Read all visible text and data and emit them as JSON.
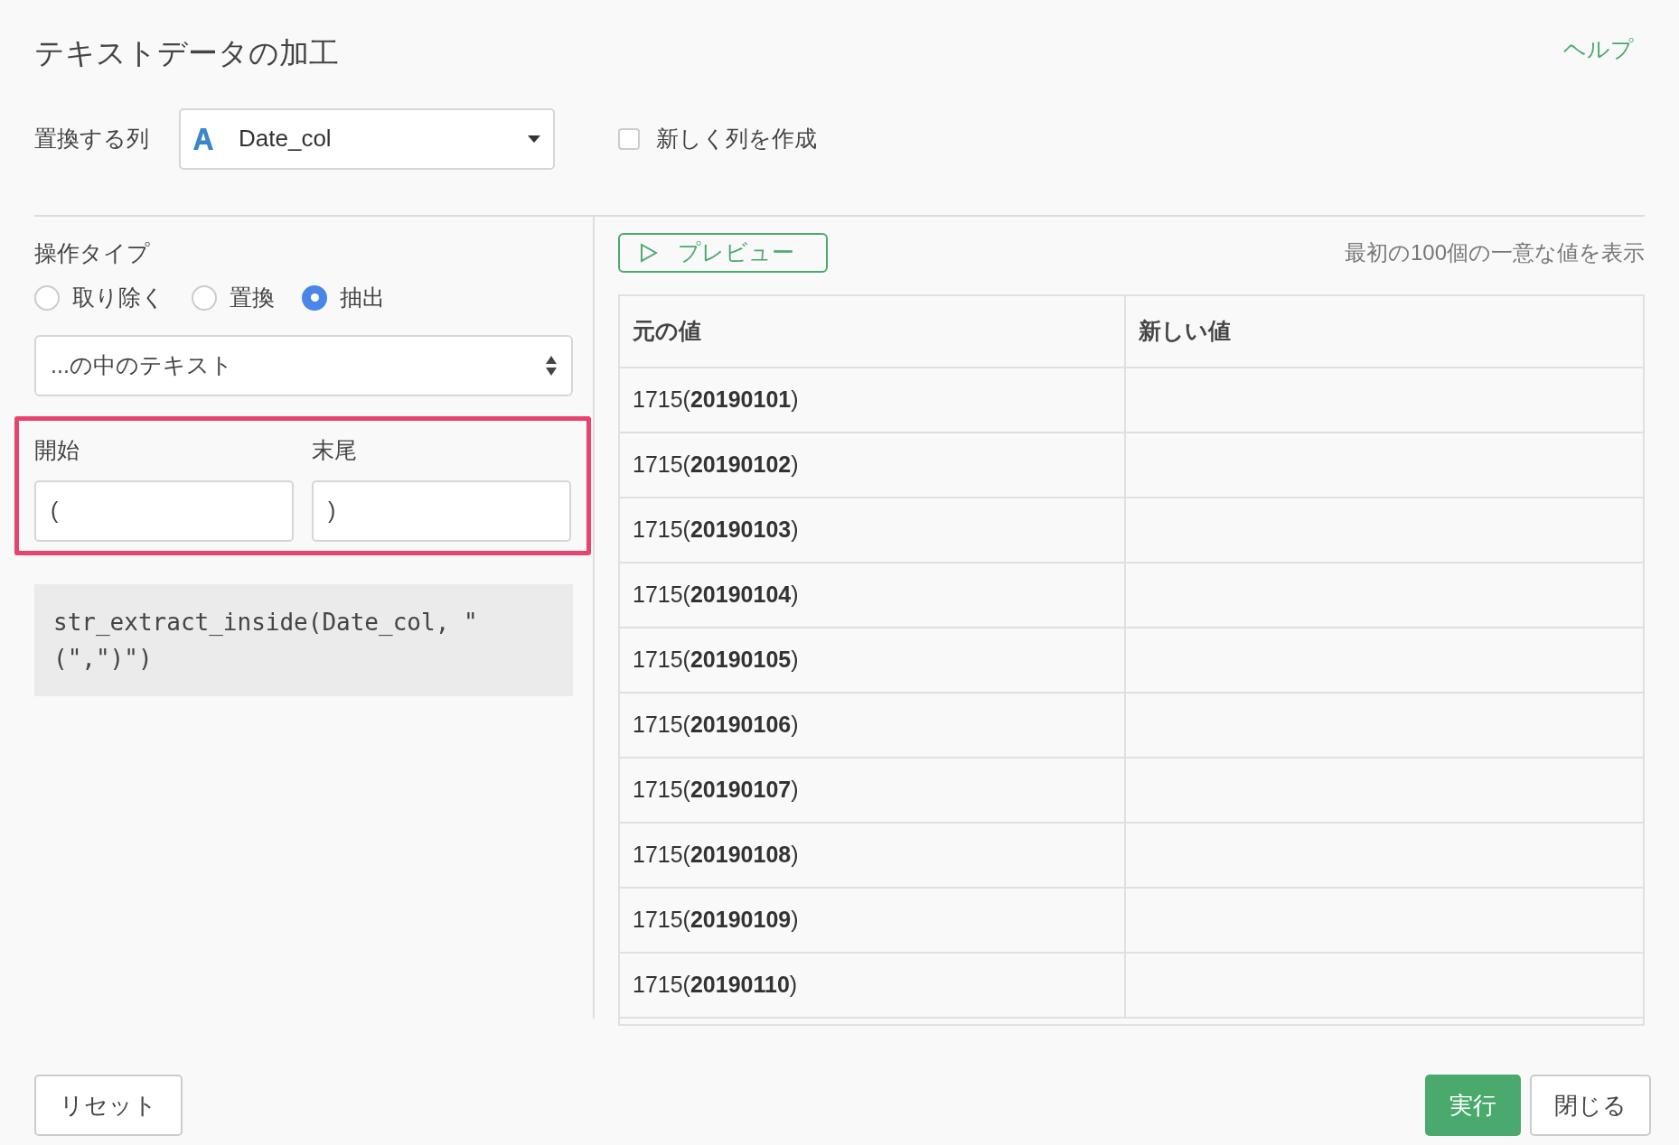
{
  "dialog": {
    "title": "テキストデータの加工",
    "help_link": "ヘルプ"
  },
  "column_select": {
    "label": "置換する列",
    "value": "Date_col"
  },
  "new_column": {
    "label": "新しく列を作成",
    "checked": false
  },
  "operation": {
    "label": "操作タイプ",
    "options": [
      {
        "label": "取り除く",
        "selected": false
      },
      {
        "label": "置換",
        "selected": false
      },
      {
        "label": "抽出",
        "selected": true
      }
    ]
  },
  "mode_select": {
    "value": "...の中のテキスト"
  },
  "start_field": {
    "label": "開始",
    "value": "("
  },
  "end_field": {
    "label": "末尾",
    "value": ")"
  },
  "expression": "str_extract_inside(Date_col, \"(\",\")\")",
  "preview": {
    "button": "プレビュー",
    "note": "最初の100個の一意な値を表示"
  },
  "table": {
    "columns": [
      "元の値",
      "新しい値"
    ],
    "rows": [
      {
        "original": "1715(**20190101**)"
      },
      {
        "original": "1715(**20190102**)"
      },
      {
        "original": "1715(**20190103**)"
      },
      {
        "original": "1715(**20190104**)"
      },
      {
        "original": "1715(**20190105**)"
      },
      {
        "original": "1715(**20190106**)"
      },
      {
        "original": "1715(**20190107**)"
      },
      {
        "original": "1715(**20190108**)"
      },
      {
        "original": "1715(**20190109**)"
      },
      {
        "original": "1715(**20190110**)"
      }
    ]
  },
  "footer": {
    "reset": "リセット",
    "run": "実行",
    "close": "閉じる"
  }
}
